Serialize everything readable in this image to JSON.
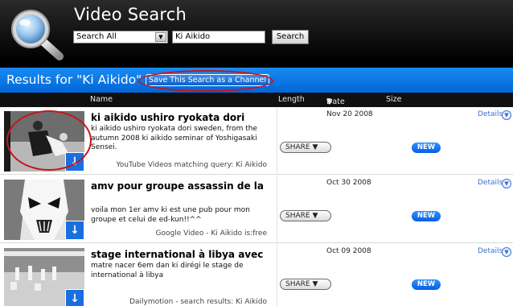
{
  "header": {
    "app_title": "Video Search",
    "search_type": "Search All",
    "search_query": "Ki Aikido",
    "search_button_label": "Search"
  },
  "results_bar": {
    "title": "Results for \"Ki Aikido\"",
    "save_channel_label": "Save This Search as a Channel"
  },
  "columns": {
    "name": "Name",
    "length": "Length",
    "date": "Date",
    "date_sort_glyph": "▼",
    "size": "Size"
  },
  "results": [
    {
      "title": "ki aikido ushiro ryokata dori",
      "description": "ki aikido ushiro ryokata dori sweden, from the autumn 2008 ki aikido seminar of Yoshigasaki Sensei.",
      "source": "YouTube Videos matching query: Ki Aikido",
      "date": "Nov 20 2008",
      "share_label": "SHARE",
      "badge": "NEW",
      "details_label": "Details"
    },
    {
      "title": "amv pour groupe assassin de la",
      "description": "voila mon 1er amv ki est une pub pour mon groupe et celui de ed-kun!!^^",
      "source": "Google Video - Ki Aikido is:free",
      "date": "Oct 30 2008",
      "share_label": "SHARE",
      "badge": "NEW",
      "details_label": "Details"
    },
    {
      "title": "stage international à libya avec",
      "description": "matre nacer 6em dan ki dirégi le stage de international à libya",
      "source": "Dailymotion - search results: Ki Aikido",
      "date": "Oct 09 2008",
      "share_label": "SHARE",
      "badge": "NEW",
      "details_label": "Details"
    }
  ],
  "colors": {
    "accent_blue": "#0a6ae0",
    "highlight_red": "#c8141c",
    "header_black": "#000000"
  },
  "icons": {
    "logo": "magnifier-icon",
    "download": "download-arrow-icon",
    "details": "chevron-down-circle-icon",
    "dropdown": "chevron-down-icon"
  }
}
